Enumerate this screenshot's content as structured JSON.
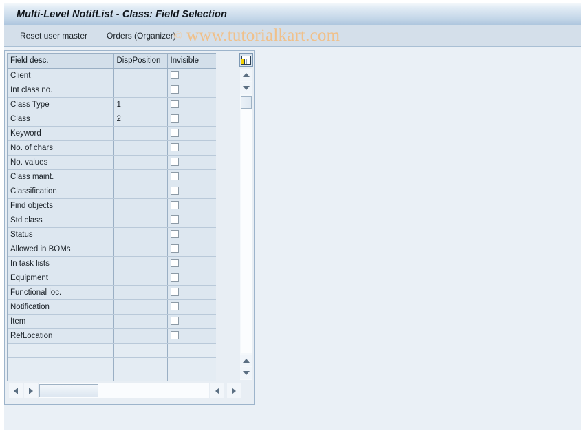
{
  "window": {
    "title": "Multi-Level NotifList - Class: Field Selection"
  },
  "toolbar": {
    "buttons": [
      {
        "label": "Reset user master",
        "name": "reset-user-master-button"
      },
      {
        "label": "Orders (Organizer)",
        "name": "orders-organizer-button"
      }
    ]
  },
  "watermark": {
    "copyright_symbol": "©",
    "text": "www.tutorialkart.com"
  },
  "grid": {
    "columns": [
      {
        "label": "Field desc.",
        "key": "field_desc"
      },
      {
        "label": "DispPosition",
        "key": "disp_position"
      },
      {
        "label": "Invisible",
        "key": "invisible"
      }
    ],
    "column_config_icon": "table-columns-icon",
    "rows": [
      {
        "field_desc": "Client",
        "disp_position": "",
        "invisible": false
      },
      {
        "field_desc": "Int class no.",
        "disp_position": "",
        "invisible": false
      },
      {
        "field_desc": "Class Type",
        "disp_position": "1",
        "invisible": false
      },
      {
        "field_desc": "Class",
        "disp_position": "2",
        "invisible": false
      },
      {
        "field_desc": "Keyword",
        "disp_position": "",
        "invisible": false
      },
      {
        "field_desc": "No. of chars",
        "disp_position": "",
        "invisible": false
      },
      {
        "field_desc": "No. values",
        "disp_position": "",
        "invisible": false
      },
      {
        "field_desc": "Class maint.",
        "disp_position": "",
        "invisible": false
      },
      {
        "field_desc": "Classification",
        "disp_position": "",
        "invisible": false
      },
      {
        "field_desc": "Find objects",
        "disp_position": "",
        "invisible": false
      },
      {
        "field_desc": "Std class",
        "disp_position": "",
        "invisible": false
      },
      {
        "field_desc": "Status",
        "disp_position": "",
        "invisible": false
      },
      {
        "field_desc": "Allowed in BOMs",
        "disp_position": "",
        "invisible": false
      },
      {
        "field_desc": "In task lists",
        "disp_position": "",
        "invisible": false
      },
      {
        "field_desc": "Equipment",
        "disp_position": "",
        "invisible": false
      },
      {
        "field_desc": "Functional loc.",
        "disp_position": "",
        "invisible": false
      },
      {
        "field_desc": "Notification",
        "disp_position": "",
        "invisible": false
      },
      {
        "field_desc": "Item",
        "disp_position": "",
        "invisible": false
      },
      {
        "field_desc": "RefLocation",
        "disp_position": "",
        "invisible": false
      }
    ],
    "empty_row_count": 3
  },
  "scrollbars": {
    "vertical": {
      "up_icon": "arrow-up-icon",
      "down_icon": "arrow-down-icon"
    },
    "horizontal": {
      "left_icon": "arrow-left-icon",
      "right_icon": "arrow-right-icon"
    }
  },
  "colors": {
    "title_bar": "#c3d6e8",
    "toolbar": "#d4dfea",
    "page_background": "#eaf0f6",
    "grid_header": "#d3dfea",
    "grid_row": "#dde7f0",
    "input_cell": "#ffffff",
    "watermark": "#f0c08a",
    "border": "#9aafc4"
  }
}
